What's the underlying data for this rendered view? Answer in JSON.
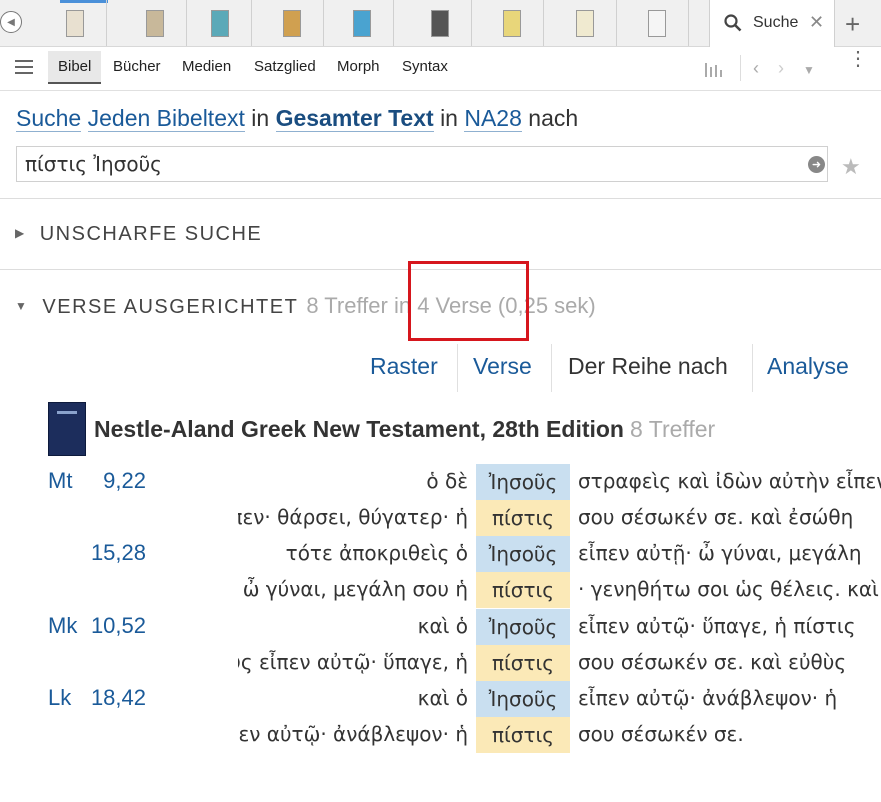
{
  "tabs": {
    "search_label": "Suche"
  },
  "toolbar": {
    "tabs": [
      "Bibel",
      "Bücher",
      "Medien",
      "Satzglied",
      "Morph",
      "Syntax"
    ]
  },
  "query": {
    "w1": "Suche",
    "w2": "Jeden Bibeltext",
    "w3": "in",
    "w4": "Gesamter Text",
    "w5": "in",
    "w6": "NA28",
    "w7": "nach",
    "input_value": "πίστις Ἰησοῦς"
  },
  "sections": {
    "fuzzy": "UNSCHARFE SUCHE",
    "aligned": "VERSE AUSGERICHTET",
    "aligned_meta": "8 Treffer in 4 Verse (0,25 sek)"
  },
  "view_tabs": [
    "Raster",
    "Verse",
    "Der Reihe nach",
    "Analyse"
  ],
  "result_book": {
    "title": "Nestle-Aland Greek New Testament, 28th Edition",
    "count": "8 Treffer"
  },
  "rows": [
    {
      "book": "Mt",
      "cv": "9,22",
      "left": "ὁ δὲ",
      "hit": "Ἰησοῦς",
      "right": "στραφεὶς καὶ ἰδὼν αὐτὴν εἶπεν",
      "color": "blue"
    },
    {
      "book": "",
      "cv": "",
      "left": "εἶπεν· θάρσει, θύγατερ· ἡ",
      "hit": "πίστις",
      "right": "σου σέσωκέν σε. καὶ ἐσώθη",
      "color": "yellow"
    },
    {
      "book": "",
      "cv": "15,28",
      "left": "τότε ἀποκριθεὶς ὁ",
      "hit": "Ἰησοῦς",
      "right": "εἶπεν αὐτῇ· ὦ γύναι, μεγάλη",
      "color": "blue"
    },
    {
      "book": "",
      "cv": "",
      "left": "αὐτῇ· ὦ γύναι, μεγάλη σου ἡ",
      "hit": "πίστις",
      "right": "· γενηθήτω σοι ὡς θέλεις. καὶ",
      "color": "yellow"
    },
    {
      "book": "Mk",
      "cv": "10,52",
      "left": "καὶ ὁ",
      "hit": "Ἰησοῦς",
      "right": "εἶπεν αὐτῷ· ὕπαγε, ἡ πίστις",
      "color": "blue"
    },
    {
      "book": "",
      "cv": "",
      "left": "Ἰησοῦς εἶπεν αὐτῷ· ὕπαγε, ἡ",
      "hit": "πίστις",
      "right": "σου σέσωκέν σε. καὶ εὐθὺς",
      "color": "yellow"
    },
    {
      "book": "Lk",
      "cv": "18,42",
      "left": "καὶ ὁ",
      "hit": "Ἰησοῦς",
      "right": "εἶπεν αὐτῷ· ἀνάβλεψον· ἡ",
      "color": "blue"
    },
    {
      "book": "",
      "cv": "",
      "left": "εἶπεν αὐτῷ· ἀνάβλεψον· ἡ",
      "hit": "πίστις",
      "right": "σου σέσωκέν σε.",
      "color": "yellow"
    }
  ]
}
